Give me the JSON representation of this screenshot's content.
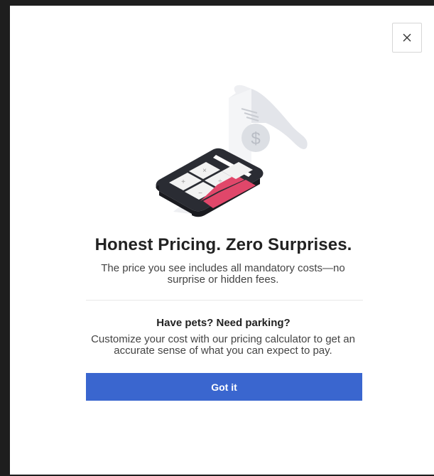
{
  "modal": {
    "close_label": "×",
    "title": "Honest Pricing. Zero Surprises.",
    "subtitle": "The price you see includes all mandatory costs—no surprise or hidden fees.",
    "question_heading": "Have pets? Need parking?",
    "question_body": "Customize your cost with our pricing calculator to get an accurate sense of what you can expect to pay.",
    "cta_label": "Got it",
    "receipt_symbol": "$"
  },
  "colors": {
    "accent": "#3a66cf",
    "calculator_key": "#e0476a"
  },
  "icons": {
    "close": "close-icon",
    "illustration": "calculator-receipt-illustration"
  }
}
